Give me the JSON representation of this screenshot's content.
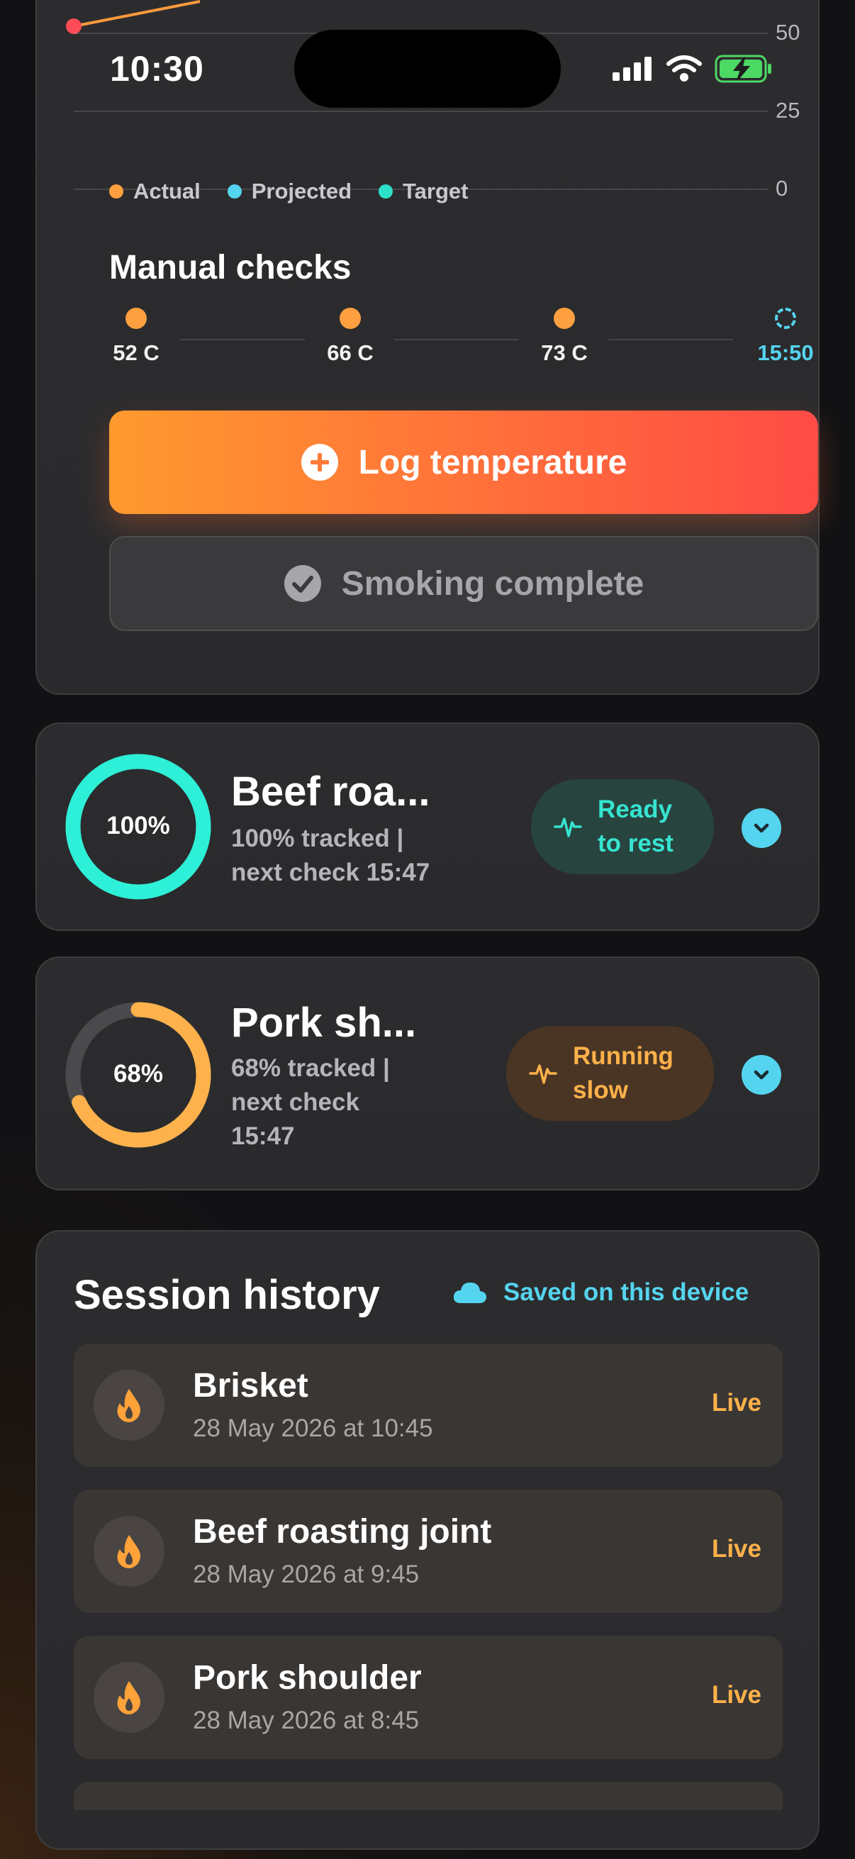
{
  "status_bar": {
    "time": "10:30"
  },
  "chart": {
    "y_ticks": [
      "50",
      "25",
      "0"
    ],
    "legend": [
      {
        "label": "Actual",
        "color": "#ffa040"
      },
      {
        "label": "Projected",
        "color": "#55d4ef"
      },
      {
        "label": "Target",
        "color": "#2fe0c8"
      }
    ]
  },
  "manual_checks": {
    "title": "Manual checks",
    "checks": [
      {
        "label": "52 C",
        "pending": false
      },
      {
        "label": "66 C",
        "pending": false
      },
      {
        "label": "73 C",
        "pending": false
      },
      {
        "label": "15:50",
        "pending": true
      }
    ]
  },
  "actions": {
    "log_temperature": "Log temperature",
    "smoking_complete": "Smoking complete"
  },
  "sessions": [
    {
      "percent_label": "100%",
      "progress": 1.0,
      "title": "Beef roa...",
      "subtitle_line1": "100% tracked |",
      "subtitle_line2": "next check 15:47",
      "status_line1": "Ready",
      "status_line2": "to rest",
      "status_color": "#36e4d0"
    },
    {
      "percent_label": "68%",
      "progress": 0.68,
      "title": "Pork sh...",
      "subtitle_line1": "68% tracked |",
      "subtitle_line2": "next check",
      "subtitle_line3": "15:47",
      "status_line1": "Running",
      "status_line2": "slow",
      "status_color": "#ffb14a"
    }
  ],
  "history": {
    "title": "Session history",
    "saved_label": "Saved on this device",
    "items": [
      {
        "name": "Brisket",
        "date": "28 May 2026 at 10:45",
        "badge": "Live"
      },
      {
        "name": "Beef roasting joint",
        "date": "28 May 2026 at 9:45",
        "badge": "Live"
      },
      {
        "name": "Pork shoulder",
        "date": "28 May 2026 at 8:45",
        "badge": "Live"
      }
    ]
  },
  "colors": {
    "accent_orange": "#ffa040",
    "accent_cyan": "#55d4ef",
    "accent_teal": "#36e4d0",
    "primary_gradient_start": "#ff9a2e",
    "primary_gradient_end": "#ff4b46"
  }
}
